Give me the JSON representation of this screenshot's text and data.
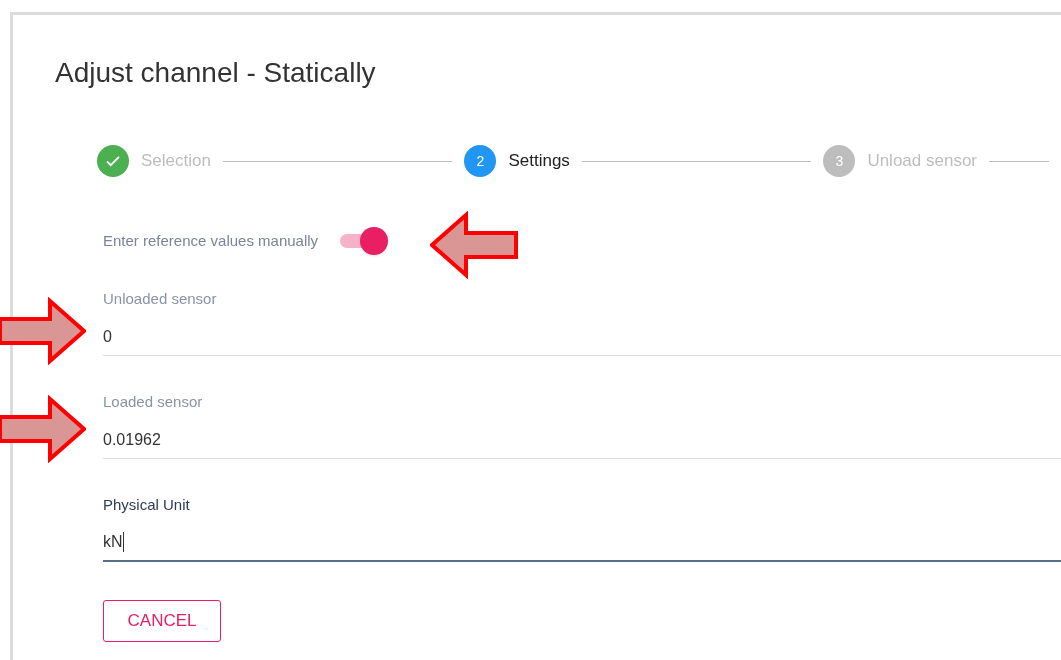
{
  "dialog": {
    "title": "Adjust channel - Statically"
  },
  "steps": [
    {
      "label": "Selection",
      "completed": true,
      "selected": false
    },
    {
      "number": "2",
      "label": "Settings",
      "completed": false,
      "selected": true
    },
    {
      "number": "3",
      "label": "Unload sensor",
      "completed": false,
      "selected": false
    }
  ],
  "manual_toggle": {
    "label": "Enter reference values manually",
    "on": true
  },
  "fields": [
    {
      "label": "Unloaded sensor",
      "value": "0",
      "focused": false
    },
    {
      "label": "Loaded sensor",
      "value": "0.01962",
      "focused": false
    },
    {
      "label": "Physical Unit",
      "value": "kN",
      "focused": true
    }
  ],
  "buttons": [
    {
      "label": "CANCEL"
    }
  ],
  "annotations": [
    {
      "kind": "arrow",
      "points_left": true
    },
    {
      "kind": "arrow",
      "points_left": false
    },
    {
      "kind": "arrow",
      "points_left": false
    }
  ]
}
